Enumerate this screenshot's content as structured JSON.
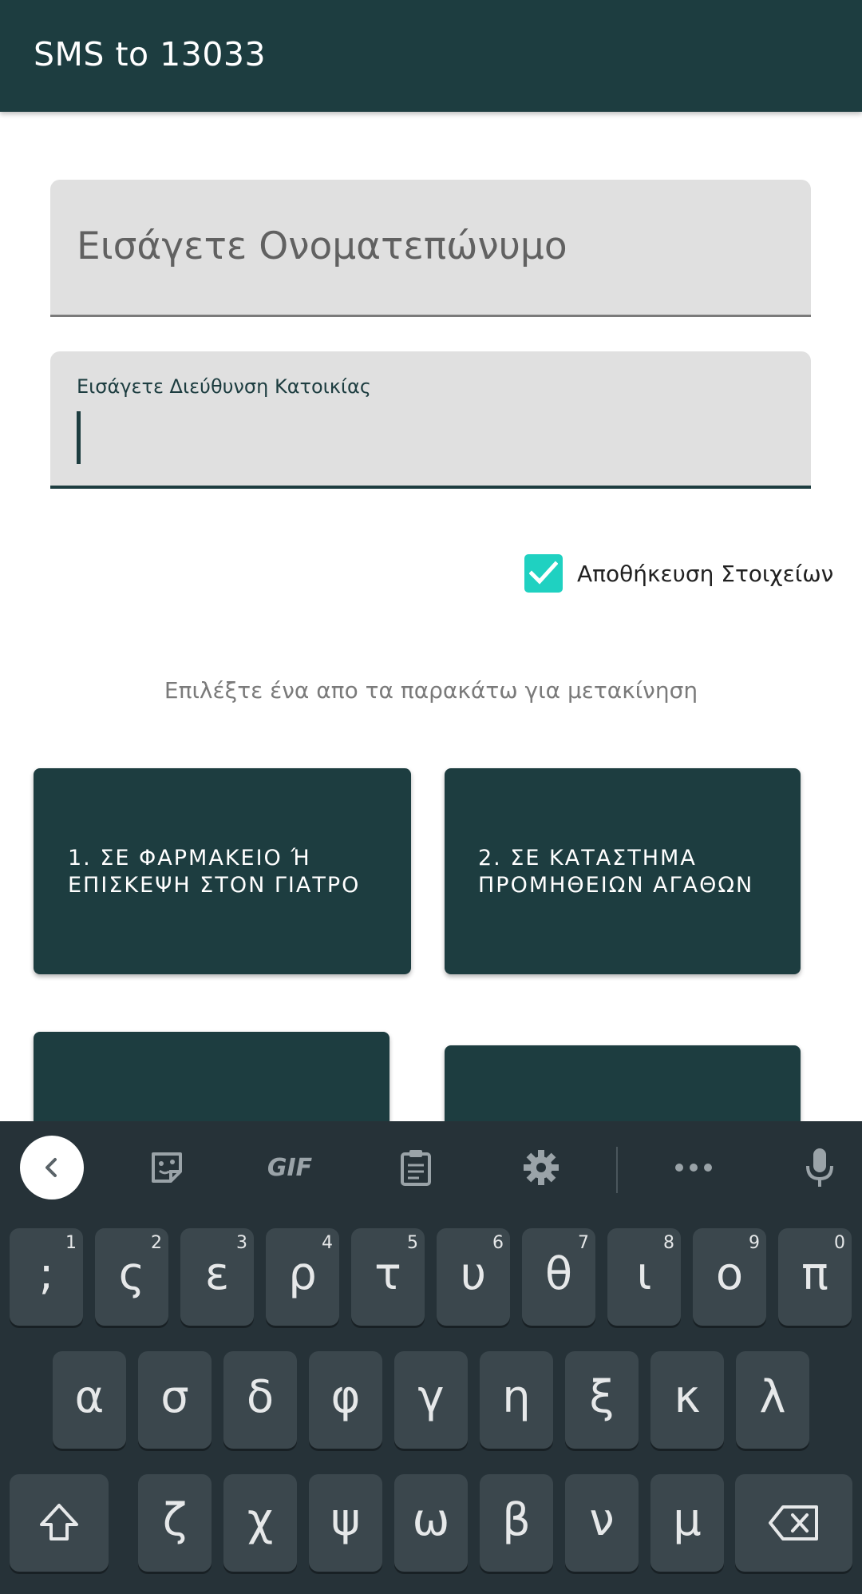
{
  "appbar": {
    "title": "SMS to 13033"
  },
  "form": {
    "name_placeholder": "Εισάγετε Ονοματεπώνυμο",
    "address_label": "Εισάγετε Διεύθυνση Κατοικίας",
    "address_value": "",
    "save_checkbox_label": "Αποθήκευση Στοιχείων",
    "save_checked": true
  },
  "hint": "Επιλέξτε ένα απο τα παρακάτω για μετακίνηση",
  "options": [
    {
      "label": "1. ΣΕ ΦΑΡΜΑΚΕΙΟ Ή\nΕΠΙΣΚΕΨΗ ΣΤΟΝ ΓΙΑΤΡΟ"
    },
    {
      "label": "2. ΣΕ ΚΑΤΑΣΤΗΜΑ\nΠΡΟΜΗΘΕΙΩΝ ΑΓΑΘΩΝ"
    },
    {
      "label": ""
    },
    {
      "label": ""
    }
  ],
  "keyboard": {
    "toolbar": [
      "back-icon",
      "sticker-icon",
      "gif-icon",
      "clipboard-icon",
      "settings-icon",
      "more-icon",
      "mic-icon"
    ],
    "gif_label": "GIF",
    "row1": [
      {
        "ch": ";",
        "num": "1"
      },
      {
        "ch": "ς",
        "num": "2"
      },
      {
        "ch": "ε",
        "num": "3"
      },
      {
        "ch": "ρ",
        "num": "4"
      },
      {
        "ch": "τ",
        "num": "5"
      },
      {
        "ch": "υ",
        "num": "6"
      },
      {
        "ch": "θ",
        "num": "7"
      },
      {
        "ch": "ι",
        "num": "8"
      },
      {
        "ch": "ο",
        "num": "9"
      },
      {
        "ch": "π",
        "num": "0"
      }
    ],
    "row2": [
      "α",
      "σ",
      "δ",
      "φ",
      "γ",
      "η",
      "ξ",
      "κ",
      "λ"
    ],
    "row3": [
      "ζ",
      "χ",
      "ψ",
      "ω",
      "β",
      "ν",
      "μ"
    ],
    "colors": {
      "background": "#263238",
      "key": "#3b474d",
      "accent": "#1d3d40",
      "checkbox": "#1fd1c1"
    }
  }
}
